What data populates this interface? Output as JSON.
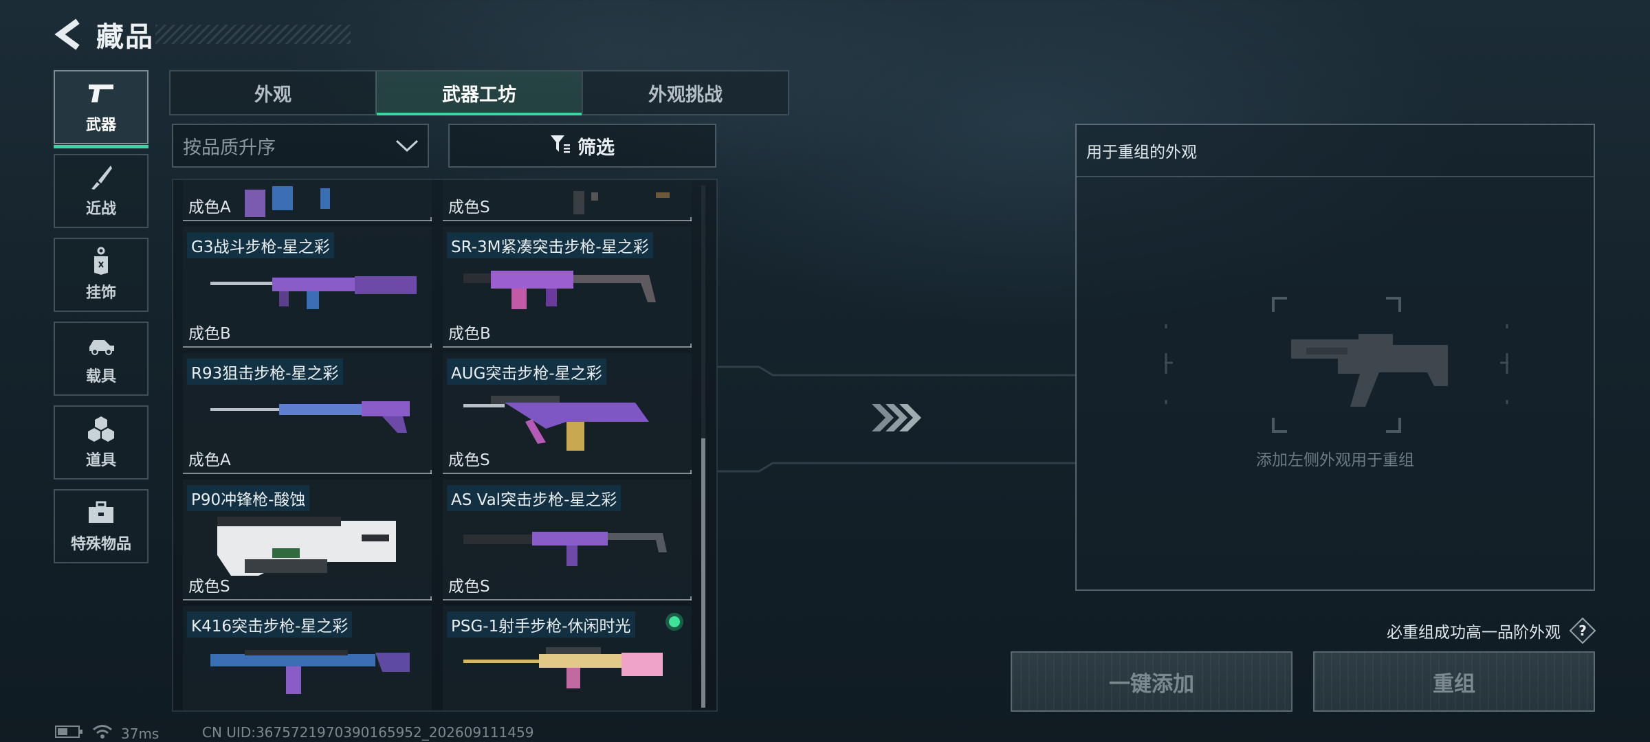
{
  "header": {
    "title": "藏品"
  },
  "rail": {
    "items": [
      {
        "label": "武器",
        "icon": "pistol-icon",
        "active": true
      },
      {
        "label": "近战",
        "icon": "knife-icon",
        "active": false
      },
      {
        "label": "挂饰",
        "icon": "charm-icon",
        "active": false
      },
      {
        "label": "载具",
        "icon": "vehicle-icon",
        "active": false
      },
      {
        "label": "道具",
        "icon": "grenade-icon",
        "active": false
      },
      {
        "label": "特殊物品",
        "icon": "toolbox-icon",
        "active": false
      }
    ]
  },
  "tabs": [
    {
      "label": "外观",
      "active": false
    },
    {
      "label": "武器工坊",
      "active": true
    },
    {
      "label": "外观挑战",
      "active": false
    }
  ],
  "sort": {
    "label": "按品质升序",
    "icon": "chevron-down-icon"
  },
  "filter": {
    "label": "筛选",
    "icon": "filter-icon"
  },
  "items": [
    {
      "name": "",
      "quality": "成色A"
    },
    {
      "name": "",
      "quality": "成色S"
    },
    {
      "name": "G3战斗步枪-星之彩",
      "quality": "成色B"
    },
    {
      "name": "SR-3M紧凑突击步枪-星之彩",
      "quality": "成色B"
    },
    {
      "name": "R93狙击步枪-星之彩",
      "quality": "成色A"
    },
    {
      "name": "AUG突击步枪-星之彩",
      "quality": "成色S"
    },
    {
      "name": "P90冲锋枪-酸蚀",
      "quality": "成色S"
    },
    {
      "name": "AS Val突击步枪-星之彩",
      "quality": "成色S"
    },
    {
      "name": "K416突击步枪-星之彩",
      "quality": ""
    },
    {
      "name": "PSG-1射手步枪-休闲时光",
      "quality": "",
      "new": true
    }
  ],
  "panel": {
    "title": "用于重组的外观",
    "hint": "添加左侧外观用于重组"
  },
  "guarantee": {
    "text": "必重组成功高一品阶外观",
    "icon": "question-icon"
  },
  "buttons": {
    "add_all": "一键添加",
    "recombine": "重组"
  },
  "status": {
    "ping": "37ms",
    "uid": "CN UID:3675721970390165952_202609111459"
  },
  "colors": {
    "accent": "#3fd3a3",
    "skin_purple": "#8a5cc8",
    "skin_blue": "#3a6fb5",
    "new_dot": "#3fe39a"
  }
}
